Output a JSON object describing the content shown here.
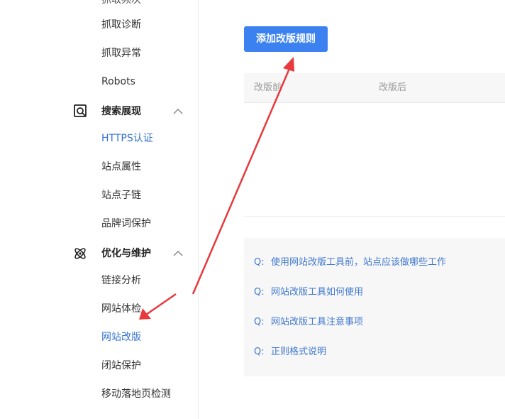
{
  "sidebar": {
    "cut_item": "抓取频次",
    "group1_items": [
      "抓取诊断",
      "抓取异常",
      "Robots"
    ],
    "group2": {
      "label": "搜索展现",
      "items": [
        "HTTPS认证",
        "站点属性",
        "站点子链",
        "品牌词保护"
      ]
    },
    "group3": {
      "label": "优化与维护",
      "items": [
        "链接分析",
        "网站体检",
        "网站改版",
        "闭站保护",
        "移动落地页检测"
      ]
    }
  },
  "main": {
    "add_button": "添加改版规则",
    "table": {
      "col_before": "改版前",
      "col_after": "改版后"
    },
    "faq": [
      {
        "prefix": "Q:",
        "text": "使用网站改版工具前，站点应该做哪些工作"
      },
      {
        "prefix": "Q:",
        "text": "网站改版工具如何使用"
      },
      {
        "prefix": "Q:",
        "text": "网站改版工具注意事项"
      },
      {
        "prefix": "Q:",
        "text": "正则格式说明"
      }
    ]
  },
  "colors": {
    "accent": "#3b82f0",
    "link": "#3f78cf",
    "active_nav": "#3471d1",
    "annotation_arrow": "#e8393d"
  }
}
